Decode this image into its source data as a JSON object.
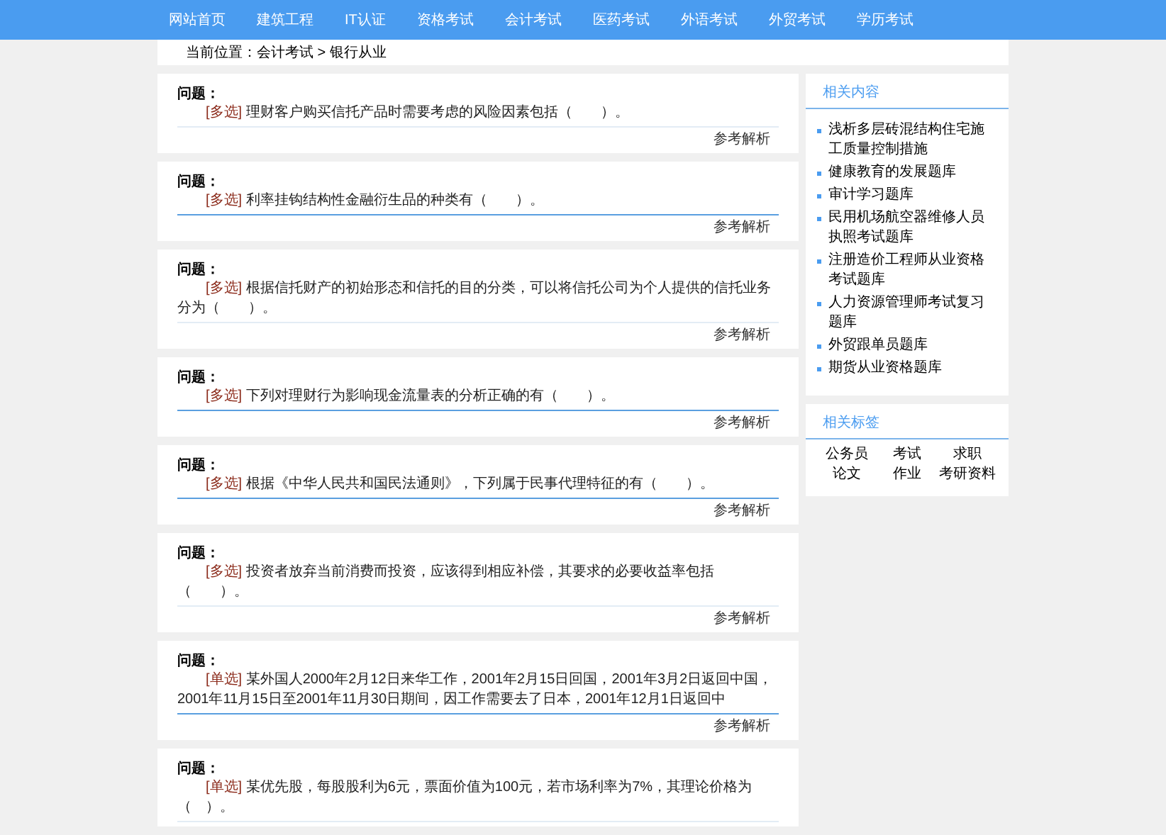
{
  "nav": [
    {
      "label": "网站首页"
    },
    {
      "label": "建筑工程"
    },
    {
      "label": "IT认证"
    },
    {
      "label": "资格考试"
    },
    {
      "label": "会计考试"
    },
    {
      "label": "医药考试"
    },
    {
      "label": "外语考试"
    },
    {
      "label": "外贸考试"
    },
    {
      "label": "学历考试"
    }
  ],
  "breadcrumb": {
    "label": "当前位置：",
    "path": "会计考试 > 银行从业"
  },
  "questions": [
    {
      "title": "问题：",
      "tag": "[多选]",
      "text": "理财客户购买信托产品时需要考虑的风险因素包括（　　）。",
      "highlighted": false,
      "link": "参考解析"
    },
    {
      "title": "问题：",
      "tag": "[多选]",
      "text": "利率挂钩结构性金融衍生品的种类有（　　）。",
      "highlighted": true,
      "link": "参考解析"
    },
    {
      "title": "问题：",
      "tag": "[多选]",
      "text": "根据信托财产的初始形态和信托的目的分类，可以将信托公司为个人提供的信托业务分为（　　）。",
      "highlighted": false,
      "link": "参考解析"
    },
    {
      "title": "问题：",
      "tag": "[多选]",
      "text": "下列对理财行为影响现金流量表的分析正确的有（　　）。",
      "highlighted": true,
      "link": "参考解析"
    },
    {
      "title": "问题：",
      "tag": "[多选]",
      "text": "根据《中华人民共和国民法通则》，下列属于民事代理特征的有（　　）。",
      "highlighted": true,
      "link": "参考解析"
    },
    {
      "title": "问题：",
      "tag": "[多选]",
      "text": "投资者放弃当前消费而投资，应该得到相应补偿，其要求的必要收益率包括（　　）。",
      "highlighted": false,
      "link": "参考解析"
    },
    {
      "title": "问题：",
      "tag": "[单选]",
      "text": "某外国人2000年2月12日来华工作，2001年2月15日回国，2001年3月2日返回中国，2001年11月15日至2001年11月30日期间，因工作需要去了日本，2001年12月1日返回中",
      "highlighted": true,
      "link": "参考解析"
    },
    {
      "title": "问题：",
      "tag": "[单选]",
      "text": "某优先股，每股股利为6元，票面价值为100元，若市场利率为7%，其理论价格为（　）。",
      "highlighted": false
    }
  ],
  "related": {
    "title": "相关内容",
    "items": [
      "浅析多层砖混结构住宅施工质量控制措施",
      "健康教育的发展题库",
      "审计学习题库",
      "民用机场航空器维修人员执照考试题库",
      "注册造价工程师从业资格考试题库",
      "人力资源管理师考试复习题库",
      "外贸跟单员题库",
      "期货从业资格题库"
    ]
  },
  "tags": {
    "title": "相关标签",
    "items": [
      "公务员",
      "考试",
      "求职",
      "论文",
      "作业",
      "考研资料"
    ]
  }
}
